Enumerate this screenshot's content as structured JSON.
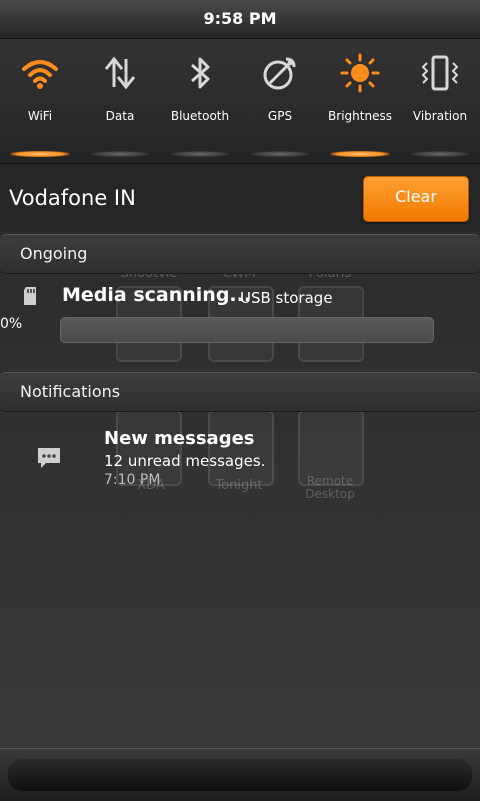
{
  "status_bar": {
    "time": "9:58 PM"
  },
  "toggles": [
    {
      "label": "WiFi",
      "icon": "wifi-icon",
      "active": true
    },
    {
      "label": "Data",
      "icon": "data-icon",
      "active": false
    },
    {
      "label": "Bluetooth",
      "icon": "bluetooth-icon",
      "active": false
    },
    {
      "label": "GPS",
      "icon": "gps-icon",
      "active": false
    },
    {
      "label": "Brightness",
      "icon": "brightness-icon",
      "active": true
    },
    {
      "label": "Vibration",
      "icon": "vibration-icon",
      "active": false
    }
  ],
  "carrier": "Vodafone IN",
  "clear_label": "Clear",
  "ongoing": {
    "header": "Ongoing",
    "item": {
      "title": "Media scanning...",
      "subtitle": "USB storage",
      "percent_text": "0%",
      "progress": 0
    }
  },
  "notifications": {
    "header": "Notifications",
    "item": {
      "title": "New messages",
      "text": "12 unread messages.",
      "time": "7:10 PM"
    }
  },
  "background_shortcuts": [
    "Shootvie",
    "CWM",
    "Polaris",
    "XDA",
    "Tonight",
    "Remote Desktop"
  ],
  "colors": {
    "accent": "#ff8c1a",
    "panel": "#2b2b2b"
  }
}
